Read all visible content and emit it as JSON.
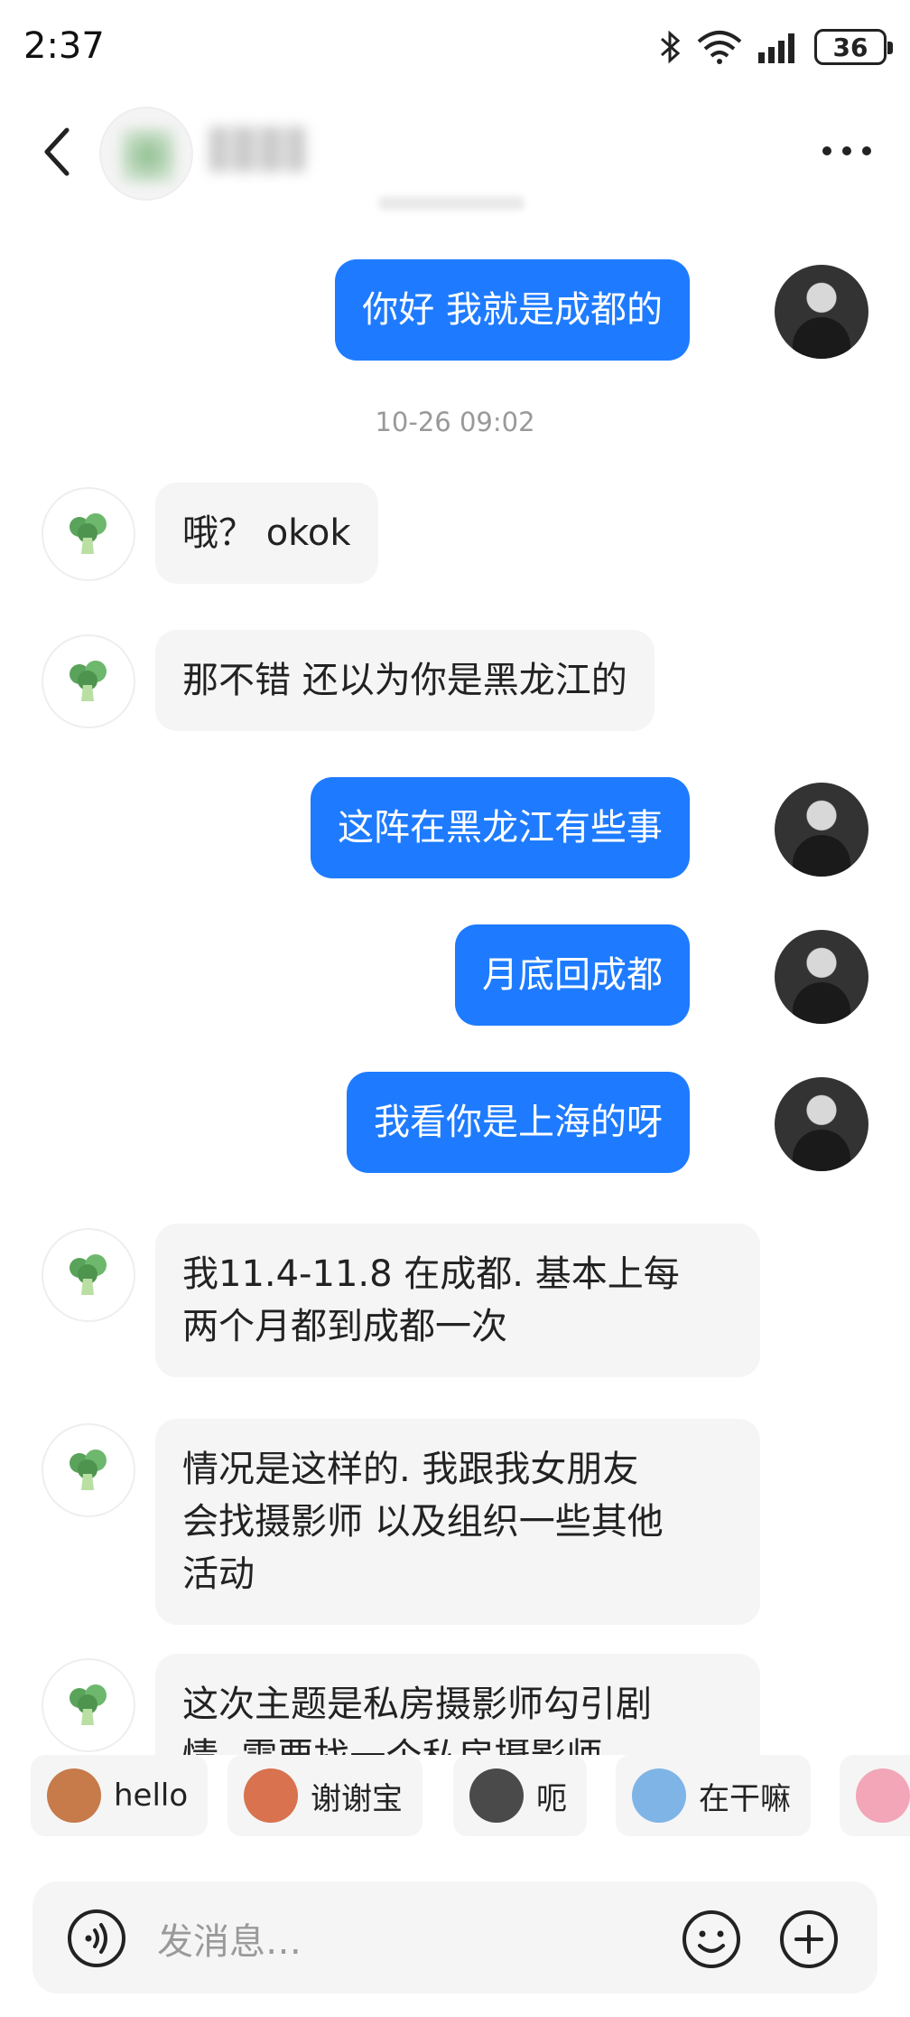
{
  "status": {
    "time": "2:37",
    "battery": "36"
  },
  "header": {
    "back_icon": "chevron-left-icon",
    "more_icon": "more-dots-icon"
  },
  "messages": [
    {
      "side": "me",
      "text": "你好 我就是成都的"
    },
    {
      "type": "timestamp",
      "text": "10-26 09:02"
    },
    {
      "side": "other",
      "text": "哦？ okok"
    },
    {
      "side": "other",
      "text": "那不错 还以为你是黑龙江的"
    },
    {
      "side": "me",
      "text": "这阵在黑龙江有些事"
    },
    {
      "side": "me",
      "text": "月底回成都"
    },
    {
      "side": "me",
      "text": "我看你是上海的呀"
    },
    {
      "side": "other",
      "lines": [
        "我11.4-11.8 在成都. 基本上每",
        "两个月都到成都一次"
      ]
    },
    {
      "side": "other",
      "lines": [
        "情况是这样的. 我跟我女朋友",
        "会找摄影师 以及组织一些其他",
        "活动"
      ]
    },
    {
      "side": "other",
      "lines": [
        "这次主题是私房摄影师勾引剧",
        "情. 需要找一个私房摄影师"
      ]
    }
  ],
  "quick_replies": [
    {
      "label": "hello",
      "icon": "monkey-sticker-icon",
      "color": "#c77a4a"
    },
    {
      "label": "谢谢宝",
      "icon": "rose-monkey-sticker-icon",
      "color": "#d8724f"
    },
    {
      "label": "呃",
      "icon": "cat-sticker-icon",
      "color": "#4a4a4a"
    },
    {
      "label": "在干嘛",
      "icon": "magnifier-sticker-icon",
      "color": "#7fb4e6"
    },
    {
      "label": "",
      "icon": "pig-sticker-icon",
      "color": "#f2a6b8"
    }
  ],
  "composer": {
    "placeholder": "发消息…",
    "voice_icon": "voice-icon",
    "emoji_icon": "emoji-icon",
    "plus_icon": "plus-icon"
  },
  "colors": {
    "accent": "#1e7bff",
    "other_bubble": "#f5f5f5"
  }
}
